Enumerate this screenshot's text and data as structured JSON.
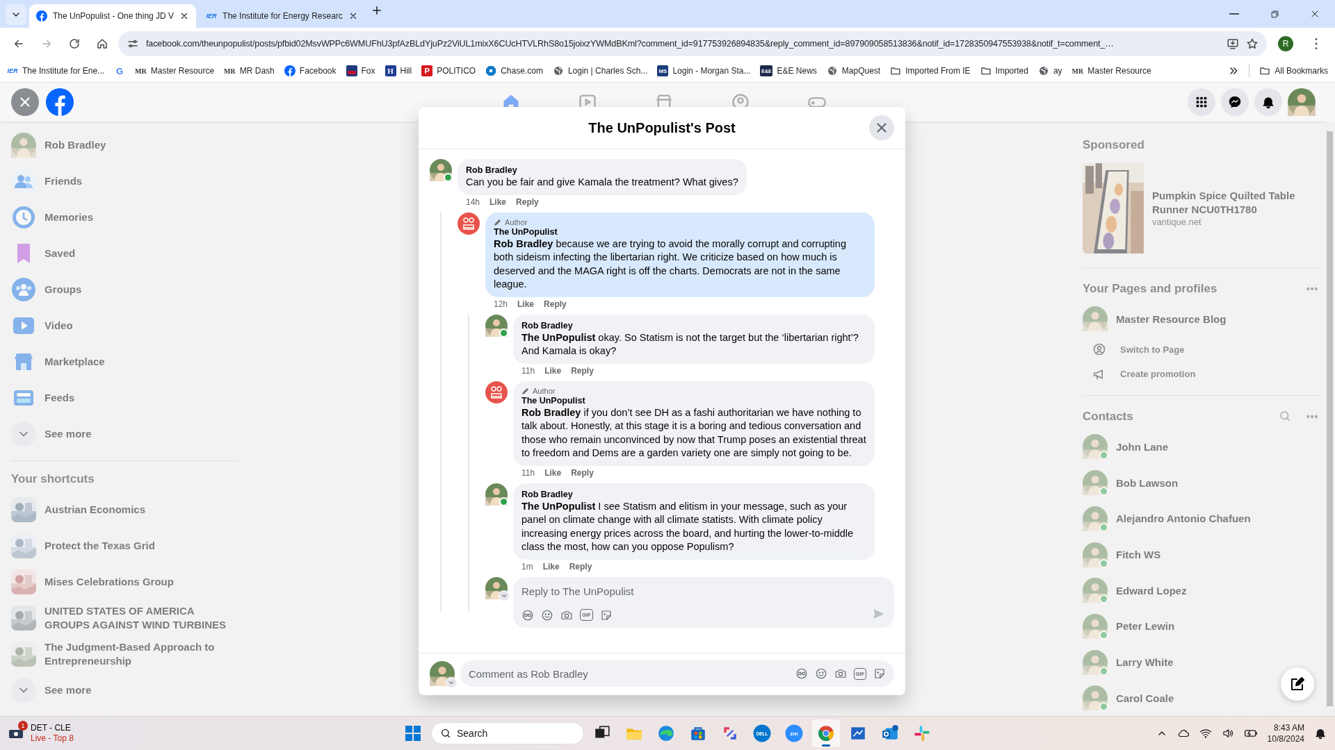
{
  "browser": {
    "tabs": [
      {
        "title": "The UnPopulist - One thing JD V",
        "selected": true
      },
      {
        "title": "The Institute for Energy Researc",
        "mark": "IER",
        "selected": false
      }
    ],
    "url": "facebook.com/theunpopulist/posts/pfbid02MsvWPPc6WMUFhU3pfAzBLdYjuPz2ViUL1mixX6CUcHTVLRhS8o15joixzYWMdBKml?comment_id=917753926894835&reply_comment_id=897909058513836&notif_id=1728350947553938&notif_t=comment_…",
    "profile_initial": "R",
    "bookmarks": [
      {
        "label": "The Institute for Ene...",
        "mark": "IER"
      },
      {
        "mark": "G"
      },
      {
        "label": "Master Resource",
        "mark": "MR"
      },
      {
        "label": "MR Dash",
        "mark": "MR"
      },
      {
        "label": "Facebook"
      },
      {
        "label": "Fox"
      },
      {
        "label": "Hill",
        "mark": "H"
      },
      {
        "label": "POLITICO",
        "mark": "P"
      },
      {
        "label": "Chase.com"
      },
      {
        "label": "Login | Charles Sch..."
      },
      {
        "label": "Login - Morgan Sta...",
        "mark": "MS"
      },
      {
        "label": "E&E News",
        "mark": "E&E"
      },
      {
        "label": "MapQuest"
      },
      {
        "label": "Imported From IE"
      },
      {
        "label": "Imported"
      },
      {
        "label": "ay"
      },
      {
        "label": "Master Resource",
        "mark": "MR"
      }
    ],
    "all_bookmarks": "All Bookmarks"
  },
  "left_sidebar": {
    "items": [
      {
        "label": "Rob Bradley"
      },
      {
        "label": "Friends"
      },
      {
        "label": "Memories"
      },
      {
        "label": "Saved"
      },
      {
        "label": "Groups"
      },
      {
        "label": "Video"
      },
      {
        "label": "Marketplace"
      },
      {
        "label": "Feeds"
      }
    ],
    "see_more": "See more",
    "shortcuts_title": "Your shortcuts",
    "shortcuts": [
      {
        "label": "Austrian Economics"
      },
      {
        "label": "Protect the Texas Grid"
      },
      {
        "label": "Mises Celebrations Group"
      },
      {
        "label": "UNITED STATES OF AMERICA GROUPS AGAINST WIND TURBINES"
      },
      {
        "label": "The Judgment-Based Approach to Entrepreneurship"
      }
    ],
    "shortcuts_see_more": "See more"
  },
  "dialog": {
    "title": "The UnPopulist's Post",
    "comments": [
      {
        "kind": "person",
        "author": "Rob Bradley",
        "online": true,
        "highlighted": false,
        "text": "Can you be fair and give Kamala the treatment? What gives?",
        "time": "14h",
        "actions": [
          "Like",
          "Reply"
        ],
        "children": [
          {
            "kind": "page",
            "author": "The UnPopulist",
            "online": false,
            "badge": "Author",
            "highlighted": true,
            "text": "**Rob Bradley** because we are trying to avoid the morally corrupt and corrupting both sideism infecting the libertarian right. We criticize based on how much is deserved and the MAGA right is off the charts. Democrats are not in the same league.",
            "time": "12h",
            "actions": [
              "Like",
              "Reply"
            ],
            "children": [
              {
                "kind": "person",
                "author": "Rob Bradley",
                "online": true,
                "highlighted": false,
                "text": "**The UnPopulist** okay. So Statism is not the target but the ‘libertarian right’? And Kamala is okay?",
                "time": "11h",
                "actions": [
                  "Like",
                  "Reply"
                ]
              },
              {
                "kind": "page",
                "author": "The UnPopulist",
                "online": false,
                "badge": "Author",
                "highlighted": false,
                "text": "**Rob Bradley** if you don’t see DH as a fashi authoritarian we have nothing to talk about. Honestly, at this stage it is a boring and tedious conversation and those who remain unconvinced by now that Trump poses an existential threat to freedom and Dems are a garden variety one are simply not going to be.",
                "time": "11h",
                "actions": [
                  "Like",
                  "Reply"
                ]
              },
              {
                "kind": "person",
                "author": "Rob Bradley",
                "online": true,
                "highlighted": false,
                "text": "**The UnPopulist** I see Statism and elitism in your message, such as your panel on climate change with all climate statists. With climate policy increasing energy prices across the board, and hurting the lower-to-middle class the most, how can you oppose Populism?",
                "time": "1m",
                "actions": [
                  "Like",
                  "Reply"
                ]
              }
            ],
            "reply_box": {
              "placeholder": "Reply to The UnPopulist",
              "tools": [
                {
                  "kind": "avatar"
                },
                {
                  "kind": "emoji"
                },
                {
                  "kind": "camera"
                },
                {
                  "kind": "gif",
                  "mark": "GIF"
                },
                {
                  "kind": "sticker"
                }
              ]
            }
          }
        ]
      }
    ],
    "composer": {
      "placeholder": "Comment as Rob Bradley",
      "tools": [
        {
          "kind": "avatar"
        },
        {
          "kind": "emoji"
        },
        {
          "kind": "camera"
        },
        {
          "kind": "gif",
          "mark": "GIF"
        },
        {
          "kind": "sticker"
        }
      ]
    }
  },
  "right_sidebar": {
    "sponsored_title": "Sponsored",
    "ad": {
      "title": "Pumpkin Spice Quilted Table Runner NCU0TH1780",
      "domain": "vantique.net"
    },
    "pages_title": "Your Pages and profiles",
    "page": {
      "name": "Master Resource Blog"
    },
    "page_actions": [
      {
        "label": "Switch to Page"
      },
      {
        "label": "Create promotion"
      }
    ],
    "contacts_title": "Contacts",
    "contacts": [
      {
        "name": "John Lane",
        "online": true
      },
      {
        "name": "Bob Lawson",
        "online": true
      },
      {
        "name": "Alejandro Antonio Chafuen",
        "online": true
      },
      {
        "name": "Fitch WS",
        "online": true
      },
      {
        "name": "Edward Lopez",
        "online": true
      },
      {
        "name": "Peter Lewin",
        "online": true
      },
      {
        "name": "Larry White",
        "online": true
      },
      {
        "name": "Carol Coale",
        "online": true
      }
    ]
  },
  "taskbar": {
    "widget": {
      "title": "DET - CLE",
      "subtitle": "Live - Top 8",
      "badge": "1"
    },
    "search_placeholder": "Search",
    "apps": [
      {
        "selected": false
      },
      {
        "selected": false
      },
      {
        "selected": false
      },
      {
        "selected": false
      },
      {
        "selected": false
      },
      {
        "mark": "DELL",
        "selected": false
      },
      {
        "mark": "zm",
        "selected": false
      },
      {
        "selected": true
      },
      {
        "selected": false
      },
      {
        "selected": false
      },
      {
        "selected": false
      }
    ],
    "time": "8:43 AM",
    "date": "10/8/2024"
  }
}
